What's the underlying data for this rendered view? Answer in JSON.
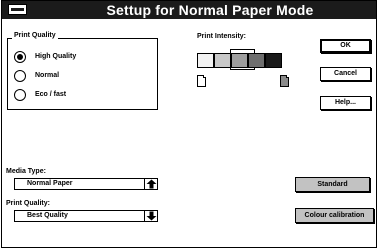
{
  "window": {
    "title": "Settup for Normal Paper Mode"
  },
  "print_quality_group": {
    "label": "Print Quality",
    "options": [
      {
        "label": "High Quality",
        "selected": true
      },
      {
        "label": "Normal",
        "selected": false
      },
      {
        "label": "Eco / fast",
        "selected": false
      }
    ]
  },
  "intensity": {
    "label": "Print Intensity:",
    "levels": [
      "#f2f2f2",
      "#c8c8c8",
      "#9e9e9e",
      "#6e6e6e",
      "#1a1a1a"
    ],
    "selected_level": 3
  },
  "buttons": {
    "ok": "OK",
    "cancel": "Cancel",
    "help": "Help...",
    "standard": "Standard",
    "colour_calibration": "Colour calibration"
  },
  "media_type": {
    "label": "Media Type:",
    "value": "Normal Paper",
    "arrow": "up-arrow-icon"
  },
  "print_quality_select": {
    "label": "Print Quality:",
    "value": "Best Quality",
    "arrow": "down-arrow-icon"
  }
}
